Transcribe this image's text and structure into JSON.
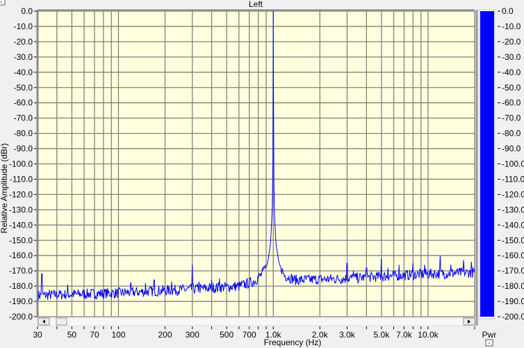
{
  "window": {
    "title": "Left",
    "collapse_button": "-",
    "meter_collapse_button": "-"
  },
  "chart_data": {
    "type": "line",
    "title": "Left",
    "xlabel": "Frequency (Hz)",
    "ylabel": "Relative Amplitude (dBr)",
    "xscale": "log",
    "xlim": [
      30,
      20000
    ],
    "ylim": [
      -200,
      0
    ],
    "grid": true,
    "x_tick_labels": [
      {
        "v": 30,
        "t": "30"
      },
      {
        "v": 50,
        "t": "50"
      },
      {
        "v": 70,
        "t": "70"
      },
      {
        "v": 100,
        "t": "100"
      },
      {
        "v": 200,
        "t": "200"
      },
      {
        "v": 300,
        "t": "300"
      },
      {
        "v": 500,
        "t": "500"
      },
      {
        "v": 700,
        "t": "700"
      },
      {
        "v": 1000,
        "t": "1.0k"
      },
      {
        "v": 2000,
        "t": "2.0k"
      },
      {
        "v": 3000,
        "t": "3.0k"
      },
      {
        "v": 5000,
        "t": "5.0k"
      },
      {
        "v": 7000,
        "t": "7.0k"
      },
      {
        "v": 10000,
        "t": "10.0k"
      }
    ],
    "x_gridlines": [
      30,
      40,
      50,
      60,
      70,
      80,
      90,
      100,
      200,
      300,
      400,
      500,
      600,
      700,
      800,
      900,
      1000,
      2000,
      3000,
      4000,
      5000,
      6000,
      7000,
      8000,
      9000,
      10000,
      20000
    ],
    "y_tick_labels": [
      "0.0",
      "-10.0",
      "-20.0",
      "-30.0",
      "-40.0",
      "-50.0",
      "-60.0",
      "-70.0",
      "-80.0",
      "-90.0",
      "-100.0",
      "-110.0",
      "-120.0",
      "-130.0",
      "-140.0",
      "-150.0",
      "-160.0",
      "-170.0",
      "-180.0",
      "-190.0",
      "-200.0"
    ],
    "series": [
      {
        "name": "Left",
        "color": "#0000ff",
        "envelope": [
          [
            30,
            -186
          ],
          [
            100,
            -184.5
          ],
          [
            300,
            -182
          ],
          [
            600,
            -180
          ],
          [
            750,
            -177
          ],
          [
            850,
            -172
          ],
          [
            920,
            -165
          ],
          [
            960,
            -152
          ],
          [
            985,
            -130
          ],
          [
            995,
            -95
          ],
          [
            1000,
            0
          ],
          [
            1005,
            -95
          ],
          [
            1015,
            -130
          ],
          [
            1040,
            -152
          ],
          [
            1090,
            -165
          ],
          [
            1180,
            -173
          ],
          [
            1400,
            -176
          ],
          [
            3000,
            -175
          ],
          [
            10000,
            -172
          ],
          [
            20000,
            -171
          ]
        ],
        "spikes": [
          [
            32,
            -172
          ],
          [
            47,
            -179
          ],
          [
            120,
            -178
          ],
          [
            150,
            -178
          ],
          [
            170,
            -176
          ],
          [
            220,
            -177
          ],
          [
            300,
            -166
          ],
          [
            330,
            -177
          ],
          [
            400,
            -176
          ],
          [
            450,
            -175
          ],
          [
            3000,
            -165
          ],
          [
            3300,
            -170
          ],
          [
            4000,
            -168
          ],
          [
            5000,
            -162
          ],
          [
            5500,
            -168
          ],
          [
            6500,
            -166
          ],
          [
            8000,
            -165
          ],
          [
            9500,
            -166
          ],
          [
            12000,
            -160
          ],
          [
            14000,
            -166
          ],
          [
            17000,
            -163
          ],
          [
            19000,
            -164
          ]
        ]
      }
    ]
  },
  "meter": {
    "label": "Pwr",
    "value_db": 0.0,
    "range": [
      -200,
      0
    ],
    "color": "#0000ff"
  }
}
